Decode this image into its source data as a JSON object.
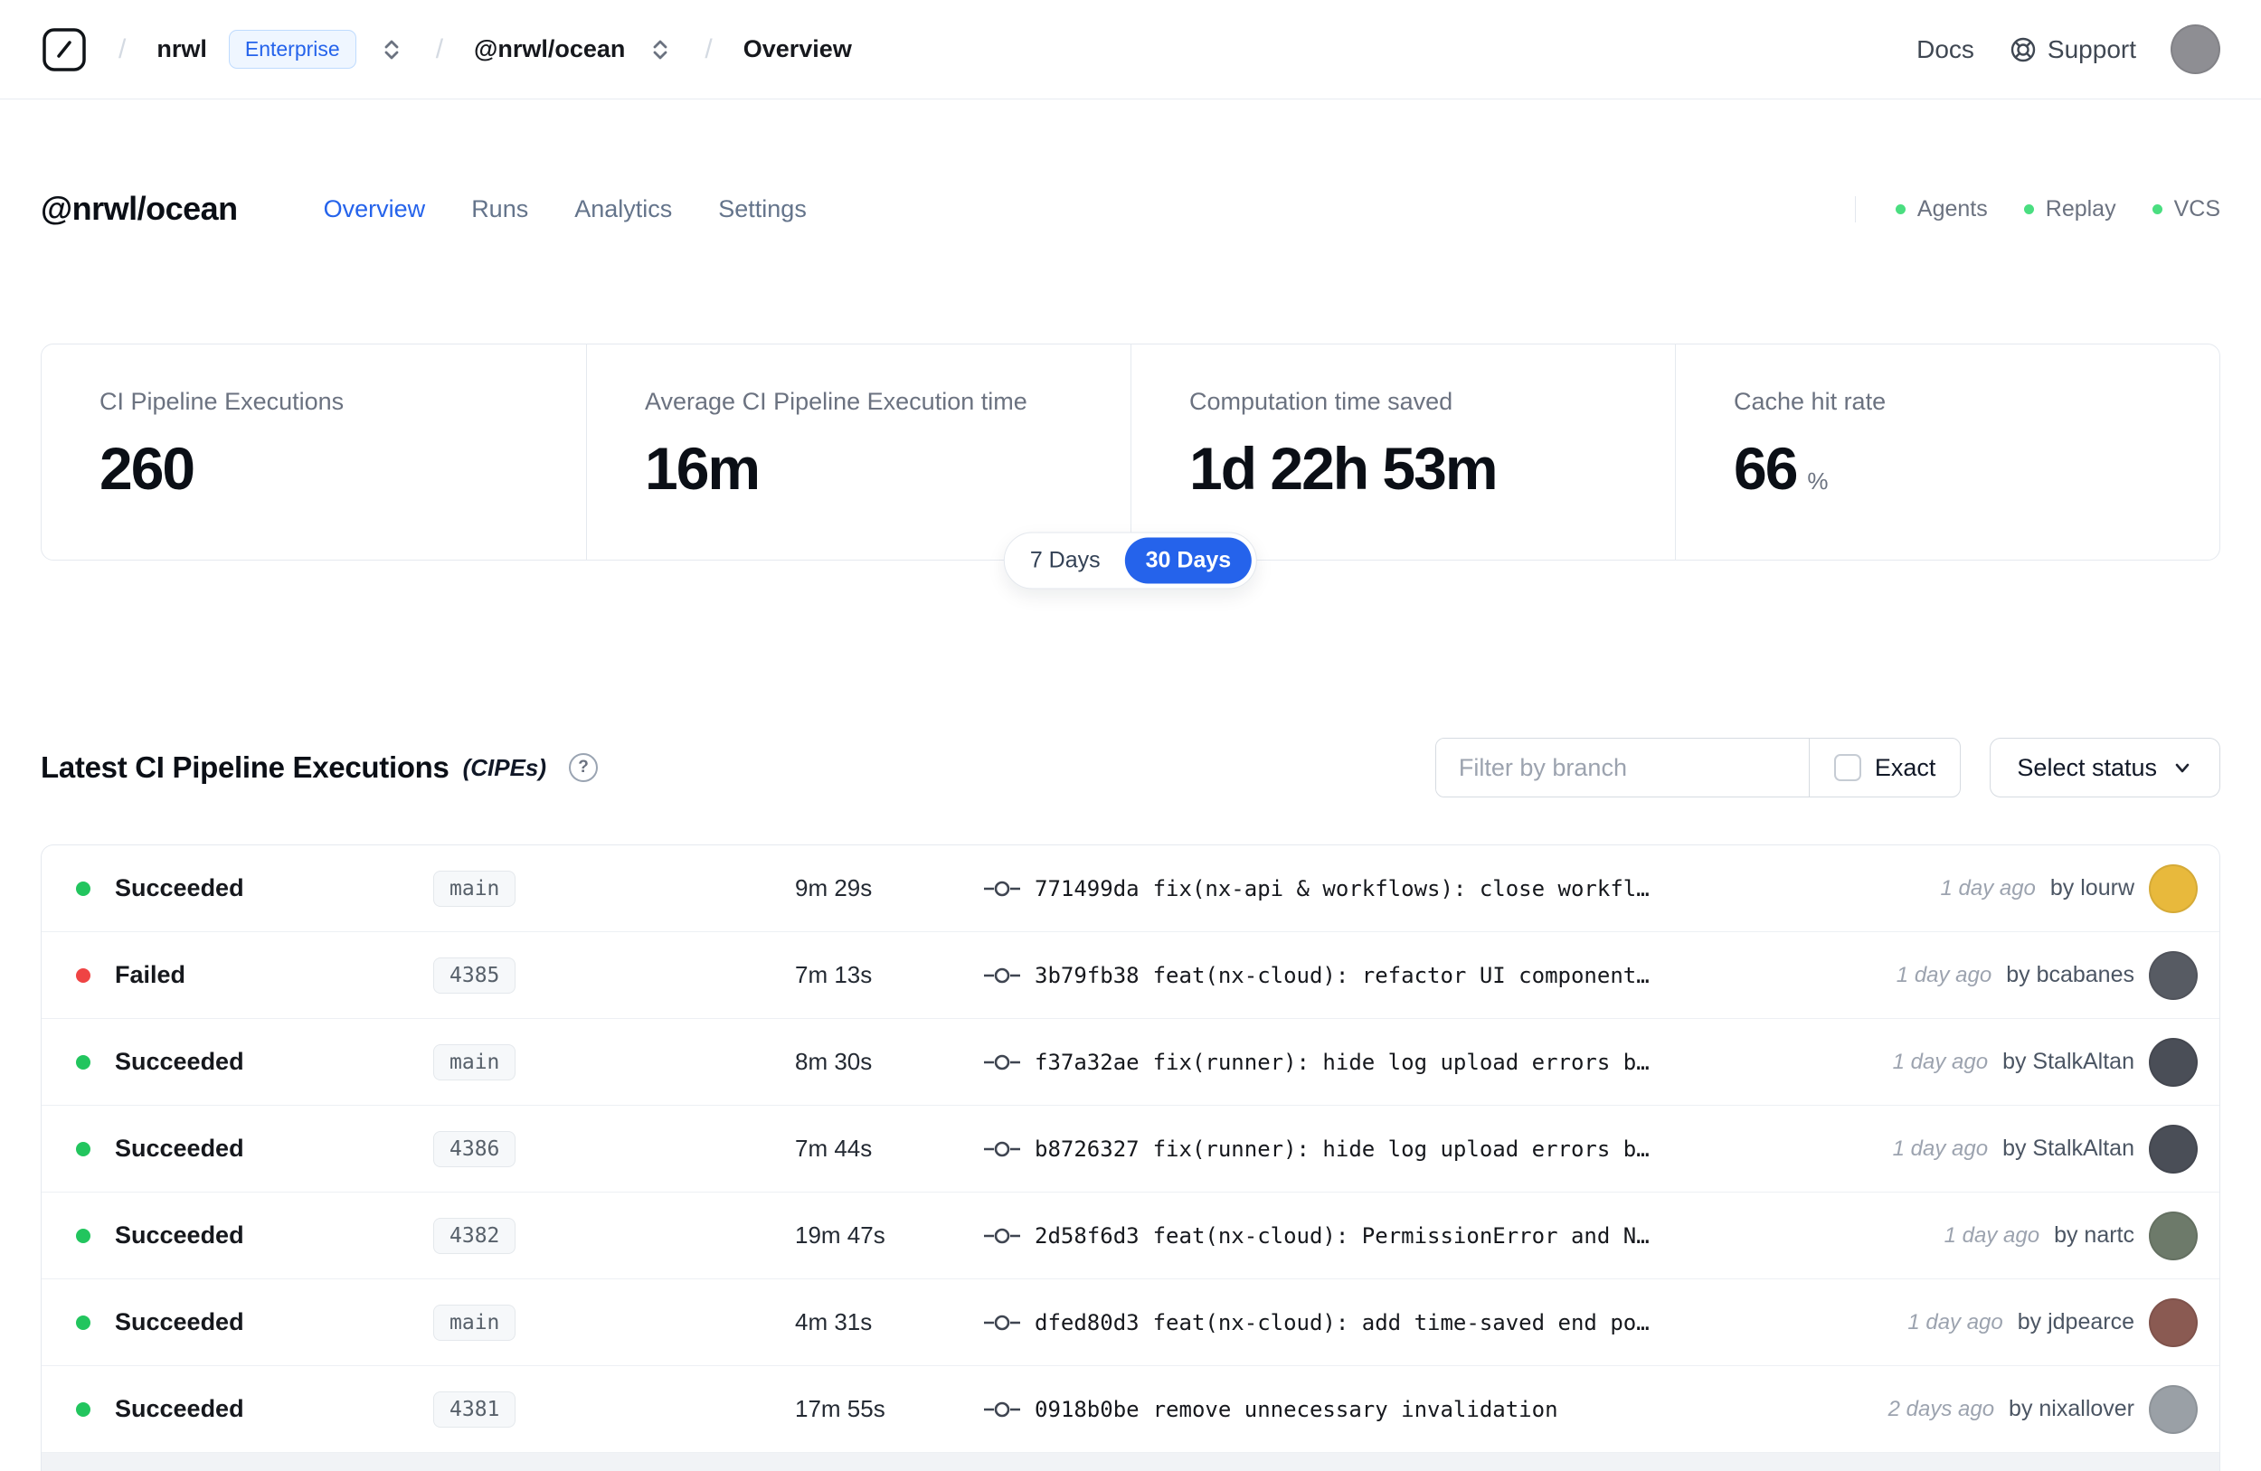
{
  "topbar": {
    "breadcrumb": {
      "separator": "/",
      "org": "nrwl",
      "org_badge": "Enterprise",
      "workspace": "@nrwl/ocean",
      "page": "Overview"
    },
    "docs_label": "Docs",
    "support_label": "Support",
    "avatar_color": "#8e8e93"
  },
  "header": {
    "title": "@nrwl/ocean",
    "tabs": [
      {
        "label": "Overview",
        "active": true
      },
      {
        "label": "Runs",
        "active": false
      },
      {
        "label": "Analytics",
        "active": false
      },
      {
        "label": "Settings",
        "active": false
      }
    ],
    "indicator_dot_color": "#4ade80",
    "status_indicators": [
      {
        "label": "Agents"
      },
      {
        "label": "Replay"
      },
      {
        "label": "VCS"
      }
    ]
  },
  "stats": {
    "cards": [
      {
        "label": "CI Pipeline Executions",
        "value": "260",
        "suffix": ""
      },
      {
        "label": "Average CI Pipeline Execution time",
        "value": "16m",
        "suffix": ""
      },
      {
        "label": "Computation time saved",
        "value": "1d 22h 53m",
        "suffix": ""
      },
      {
        "label": "Cache hit rate",
        "value": "66",
        "suffix": "%"
      }
    ],
    "range_toggle": {
      "options": [
        "7 Days",
        "30 Days"
      ],
      "selected": "30 Days"
    }
  },
  "cipes": {
    "title": "Latest CI Pipeline Executions",
    "title_suffix": "(CIPEs)",
    "help_glyph": "?",
    "filter_placeholder": "Filter by branch",
    "exact_label": "Exact",
    "status_select_label": "Select status",
    "rows": [
      {
        "status": "Succeeded",
        "status_color": "#22c55e",
        "branch": "main",
        "duration": "9m 29s",
        "commit_hash": "771499da",
        "commit_message": "fix(nx-api & workflows): close workfl…",
        "time_ago": "1 day ago",
        "author_label": "by lourw",
        "avatar_color": "#e8b93c"
      },
      {
        "status": "Failed",
        "status_color": "#ef4444",
        "branch": "4385",
        "duration": "7m 13s",
        "commit_hash": "3b79fb38",
        "commit_message": "feat(nx-cloud): refactor UI component…",
        "time_ago": "1 day ago",
        "author_label": "by bcabanes",
        "avatar_color": "#575b63"
      },
      {
        "status": "Succeeded",
        "status_color": "#22c55e",
        "branch": "main",
        "duration": "8m 30s",
        "commit_hash": "f37a32ae",
        "commit_message": "fix(runner): hide log upload errors b…",
        "time_ago": "1 day ago",
        "author_label": "by StalkAltan",
        "avatar_color": "#4a4e57"
      },
      {
        "status": "Succeeded",
        "status_color": "#22c55e",
        "branch": "4386",
        "duration": "7m 44s",
        "commit_hash": "b8726327",
        "commit_message": "fix(runner): hide log upload errors b…",
        "time_ago": "1 day ago",
        "author_label": "by StalkAltan",
        "avatar_color": "#4a4e57"
      },
      {
        "status": "Succeeded",
        "status_color": "#22c55e",
        "branch": "4382",
        "duration": "19m 47s",
        "commit_hash": "2d58f6d3",
        "commit_message": "feat(nx-cloud): PermissionError and N…",
        "time_ago": "1 day ago",
        "author_label": "by nartc",
        "avatar_color": "#6d7a6a"
      },
      {
        "status": "Succeeded",
        "status_color": "#22c55e",
        "branch": "main",
        "duration": "4m 31s",
        "commit_hash": "dfed80d3",
        "commit_message": "feat(nx-cloud): add time-saved end po…",
        "time_ago": "1 day ago",
        "author_label": "by jdpearce",
        "avatar_color": "#8a5a52"
      },
      {
        "status": "Succeeded",
        "status_color": "#22c55e",
        "branch": "4381",
        "duration": "17m 55s",
        "commit_hash": "0918b0be",
        "commit_message": "remove unnecessary invalidation",
        "time_ago": "2 days ago",
        "author_label": "by nixallover",
        "avatar_color": "#9aa0a6"
      }
    ]
  },
  "colors": {
    "accent_blue": "#2563eb",
    "success_green": "#22c55e",
    "error_red": "#ef4444",
    "indicator_green": "#4ade80"
  }
}
